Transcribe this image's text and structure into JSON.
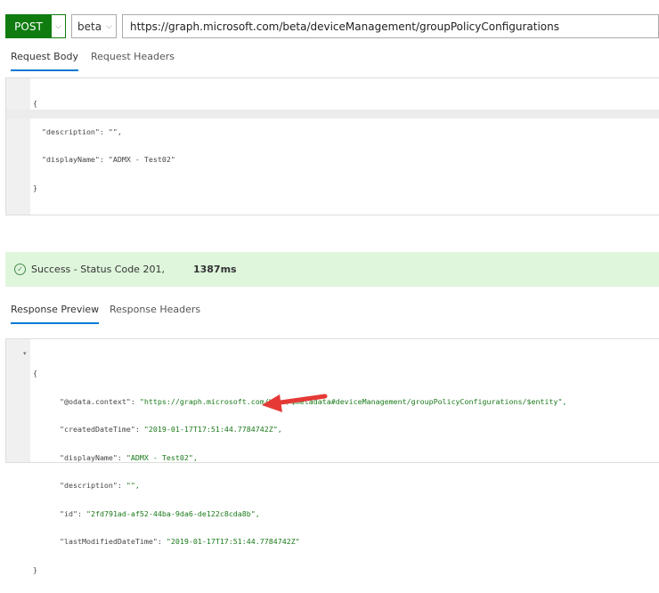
{
  "toolbar": {
    "method": "POST",
    "version": "beta",
    "url": "https://graph.microsoft.com/beta/deviceManagement/groupPolicyConfigurations"
  },
  "request_tabs": [
    {
      "label": "Request Body",
      "active": true
    },
    {
      "label": "Request Headers",
      "active": false
    }
  ],
  "request_body": {
    "lines": [
      "{",
      "  \"description\": \"\",",
      "  \"displayName\": \"ADMX - Test02\"",
      "}"
    ]
  },
  "status": {
    "text": "Success - Status Code 201,",
    "time": "1387ms",
    "color": "#dff6dd"
  },
  "response_tabs": [
    {
      "label": "Response Preview",
      "active": true
    },
    {
      "label": "Response Headers",
      "active": false
    }
  ],
  "response": {
    "open": "{",
    "fields": [
      {
        "key": "\"@odata.context\": ",
        "value": "\"https://graph.microsoft.com/beta/$metadata#deviceManagement/groupPolicyConfigurations/$entity\","
      },
      {
        "key": "\"createdDateTime\": ",
        "value": "\"2019-01-17T17:51:44.7784742Z\","
      },
      {
        "key": "\"displayName\": ",
        "value": "\"ADMX - Test02\","
      },
      {
        "key": "\"description\": ",
        "value": "\"\","
      },
      {
        "key": "\"id\": ",
        "value": "\"2fd791ad-af52-44ba-9da6-de122c8cda8b\","
      },
      {
        "key": "\"lastModifiedDateTime\": ",
        "value": "\"2019-01-17T17:51:44.7784742Z\""
      }
    ],
    "close": "}"
  },
  "colors": {
    "accent": "#107c10",
    "tab_underline": "#0078d4",
    "annotation_arrow": "#e53935"
  }
}
